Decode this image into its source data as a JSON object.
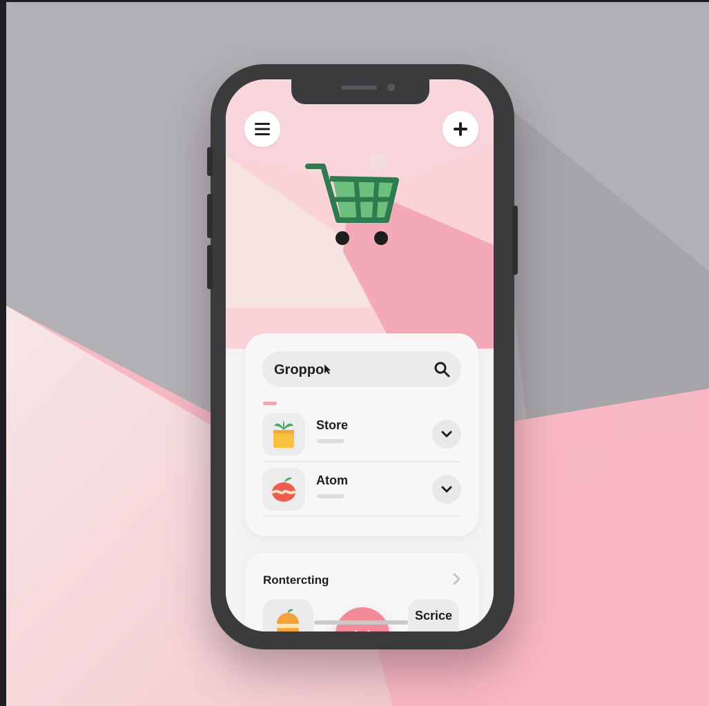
{
  "header": {
    "menu_icon": "hamburger-menu-icon",
    "add_icon": "plus-icon",
    "hero_icon": "shopping-cart-icon"
  },
  "search": {
    "value": "Groppo",
    "cursor_icon": "cursor-icon",
    "icon": "search-icon"
  },
  "list": {
    "items": [
      {
        "title": "Store",
        "icon": "potted-plant-icon",
        "action_icon": "chevron-down-icon"
      },
      {
        "title": "Atom",
        "icon": "apple-icon",
        "action_icon": "chevron-down-icon"
      }
    ]
  },
  "section": {
    "title": "Rontercting",
    "arrow_icon": "chevron-right-icon",
    "tiles": [
      {
        "icon": "burger-icon"
      },
      {
        "label": "Scrice",
        "dots": "••••"
      }
    ],
    "fab_icon": "chevron-down-icon"
  },
  "colors": {
    "accent_pink": "#f28a98",
    "cart_green": "#2f7a4f",
    "cart_fill": "#6cc07e",
    "phone_frame": "#3b3b3d"
  }
}
